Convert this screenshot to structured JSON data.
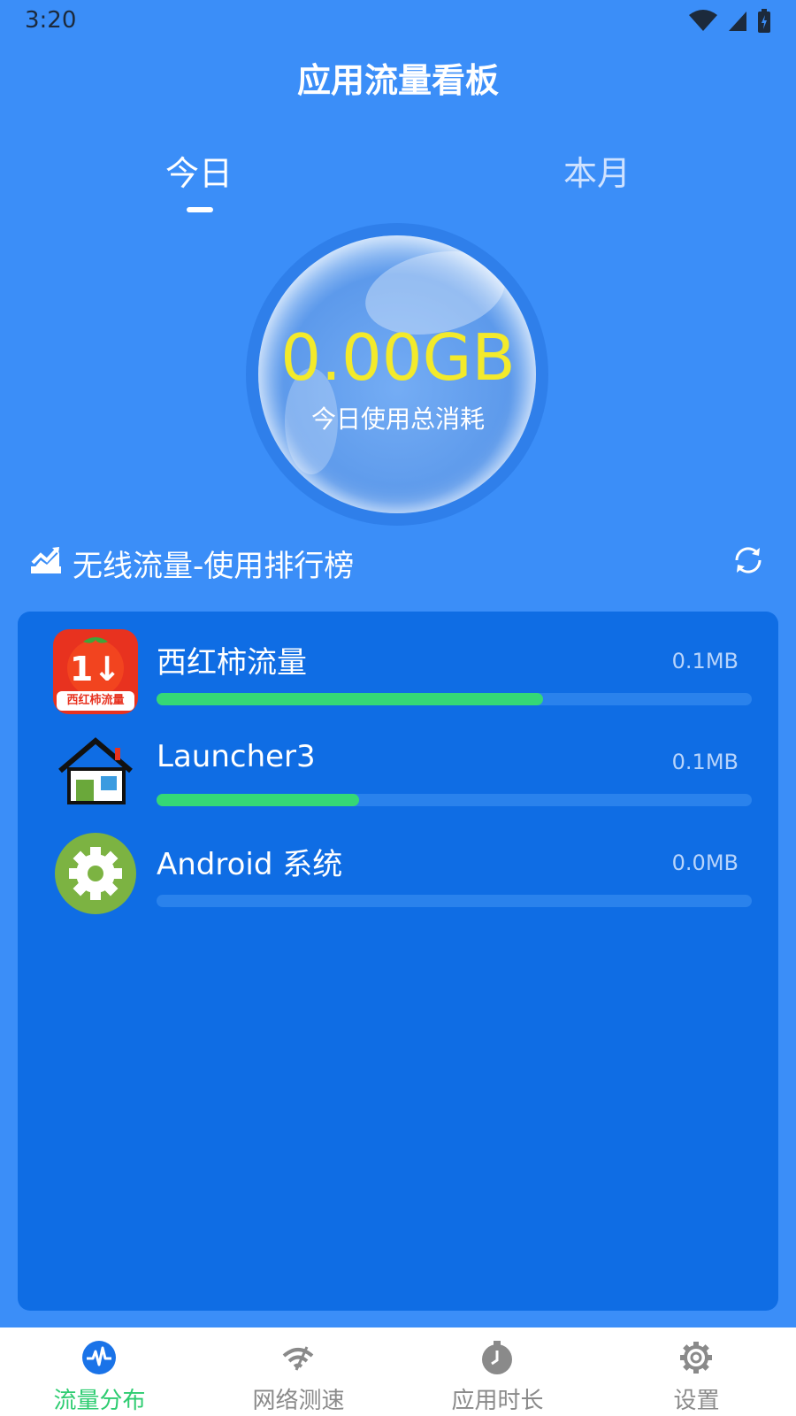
{
  "status_bar": {
    "time": "3:20"
  },
  "header": {
    "title": "应用流量看板"
  },
  "tabs": [
    {
      "label": "今日",
      "active": true
    },
    {
      "label": "本月",
      "active": false
    }
  ],
  "usage_bubble": {
    "value": "0.00GB",
    "label": "今日使用总消耗"
  },
  "ranking": {
    "title": "无线流量-使用排行榜",
    "apps": [
      {
        "name": "西红柿流量",
        "size": "0.1MB",
        "usage_fraction": 0.65,
        "icon": "tomato-icon",
        "icon_text": "西红柿流量"
      },
      {
        "name": "Launcher3",
        "size": "0.1MB",
        "usage_fraction": 0.34,
        "icon": "launcher-house-icon"
      },
      {
        "name": "Android 系统",
        "size": "0.0MB",
        "usage_fraction": 0.0,
        "icon": "android-gear-icon"
      }
    ]
  },
  "bottom_nav": [
    {
      "label": "流量分布",
      "icon": "pulse-icon",
      "active": true
    },
    {
      "label": "网络测速",
      "icon": "wifi-speed-icon",
      "active": false
    },
    {
      "label": "应用时长",
      "icon": "timer-icon",
      "active": false
    },
    {
      "label": "设置",
      "icon": "settings-gear-icon",
      "active": false
    }
  ],
  "colors": {
    "background": "#3b8ef8",
    "panel": "#0f6de4",
    "accent_green": "#35d876",
    "value_yellow": "#f3ea2b"
  }
}
